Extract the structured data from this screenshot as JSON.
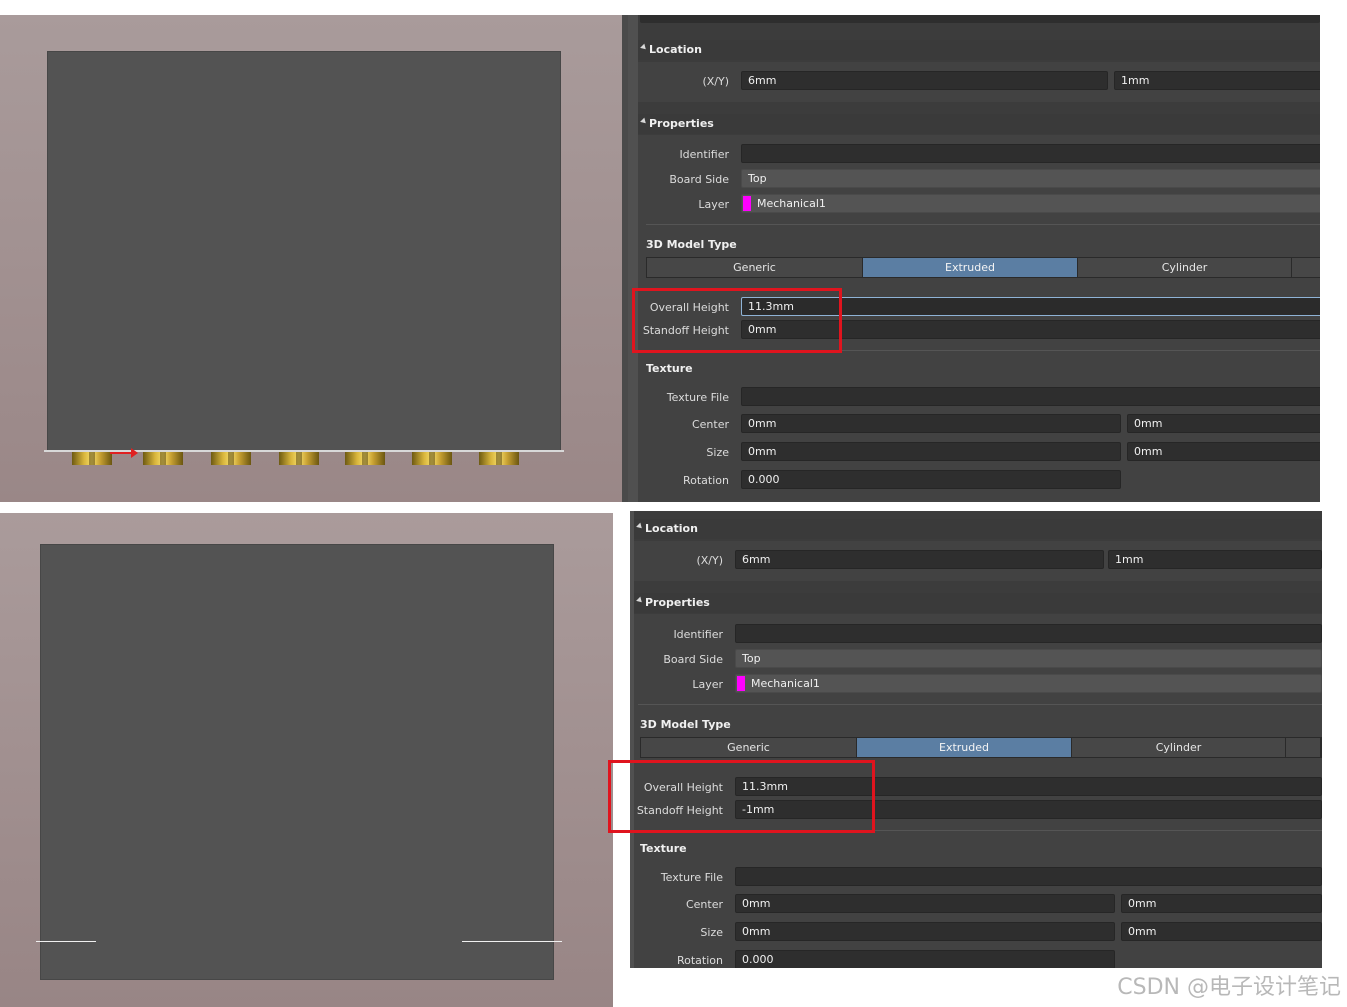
{
  "screenshots": [
    {
      "location": {
        "title": "Location",
        "xy_label": "(X/Y)",
        "x": "6mm",
        "y": "1mm"
      },
      "properties": {
        "title": "Properties",
        "identifier_label": "Identifier",
        "identifier_value": "",
        "board_side_label": "Board Side",
        "board_side_value": "Top",
        "layer_label": "Layer",
        "layer_value": "Mechanical1",
        "layer_color": "#ff00ff"
      },
      "model_type": {
        "title": "3D Model Type",
        "options": [
          "Generic",
          "Extruded",
          "Cylinder"
        ],
        "selected": "Extruded"
      },
      "dimensions": {
        "overall_label": "Overall Height",
        "overall_value": "11.3mm",
        "standoff_label": "Standoff Height",
        "standoff_value": "0mm"
      },
      "texture": {
        "title": "Texture",
        "file_label": "Texture File",
        "file_value": "",
        "center_label": "Center",
        "center_x": "0mm",
        "center_y": "0mm",
        "size_label": "Size",
        "size_x": "0mm",
        "size_y": "0mm",
        "rotation_label": "Rotation",
        "rotation_value": "0.000"
      }
    },
    {
      "location": {
        "title": "Location",
        "xy_label": "(X/Y)",
        "x": "6mm",
        "y": "1mm"
      },
      "properties": {
        "title": "Properties",
        "identifier_label": "Identifier",
        "identifier_value": "",
        "board_side_label": "Board Side",
        "board_side_value": "Top",
        "layer_label": "Layer",
        "layer_value": "Mechanical1",
        "layer_color": "#ff00ff"
      },
      "model_type": {
        "title": "3D Model Type",
        "options": [
          "Generic",
          "Extruded",
          "Cylinder"
        ],
        "selected": "Extruded"
      },
      "dimensions": {
        "overall_label": "Overall Height",
        "overall_value": "11.3mm",
        "standoff_label": "Standoff Height",
        "standoff_value": "-1mm"
      },
      "texture": {
        "title": "Texture",
        "file_label": "Texture File",
        "file_value": "",
        "center_label": "Center",
        "center_x": "0mm",
        "center_y": "0mm",
        "size_label": "Size",
        "size_x": "0mm",
        "size_y": "0mm",
        "rotation_label": "Rotation",
        "rotation_value": "0.000"
      }
    }
  ],
  "colors": {
    "highlight_box": "#e0141e",
    "selected_segment": "#5b7ea3",
    "board": "#535353",
    "viewport_background": "#a99b9b"
  },
  "watermark": "CSDN @电子设计笔记"
}
